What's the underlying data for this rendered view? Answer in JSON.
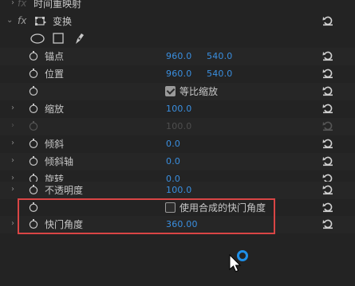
{
  "time_remap": {
    "label": "时间重映射",
    "fx": "fx"
  },
  "transform": {
    "label": "变换",
    "fx": "fx"
  },
  "properties": {
    "anchor": {
      "label": "锚点",
      "x": "960.0",
      "y": "540.0"
    },
    "position": {
      "label": "位置",
      "x": "960.0",
      "y": "540.0"
    },
    "uniform_scale": {
      "label": "等比缩放"
    },
    "scale": {
      "label": "缩放",
      "value": "100.0"
    },
    "scale_width": {
      "value": "100.0"
    },
    "skew": {
      "label": "倾斜",
      "value": "0.0"
    },
    "skew_axis": {
      "label": "倾斜轴",
      "value": "0.0"
    },
    "rotation": {
      "label": "旋转",
      "value": "0.0"
    },
    "opacity": {
      "label": "不透明度",
      "value": "100.0"
    },
    "comp_shutter": {
      "label": "使用合成的快门角度"
    },
    "shutter_angle": {
      "label": "快门角度",
      "value": "360.00"
    }
  },
  "colors": {
    "accent": "#3a8fe0",
    "highlight": "#d94545",
    "cursor": "#1e8fe8"
  },
  "icons": [
    "chevron-right-icon",
    "chevron-down-icon",
    "stopwatch-icon",
    "reset-icon",
    "ellipse-mask-icon",
    "rectangle-mask-icon",
    "pen-icon",
    "transform-icon",
    "checkbox-icon",
    "cursor-icon"
  ]
}
